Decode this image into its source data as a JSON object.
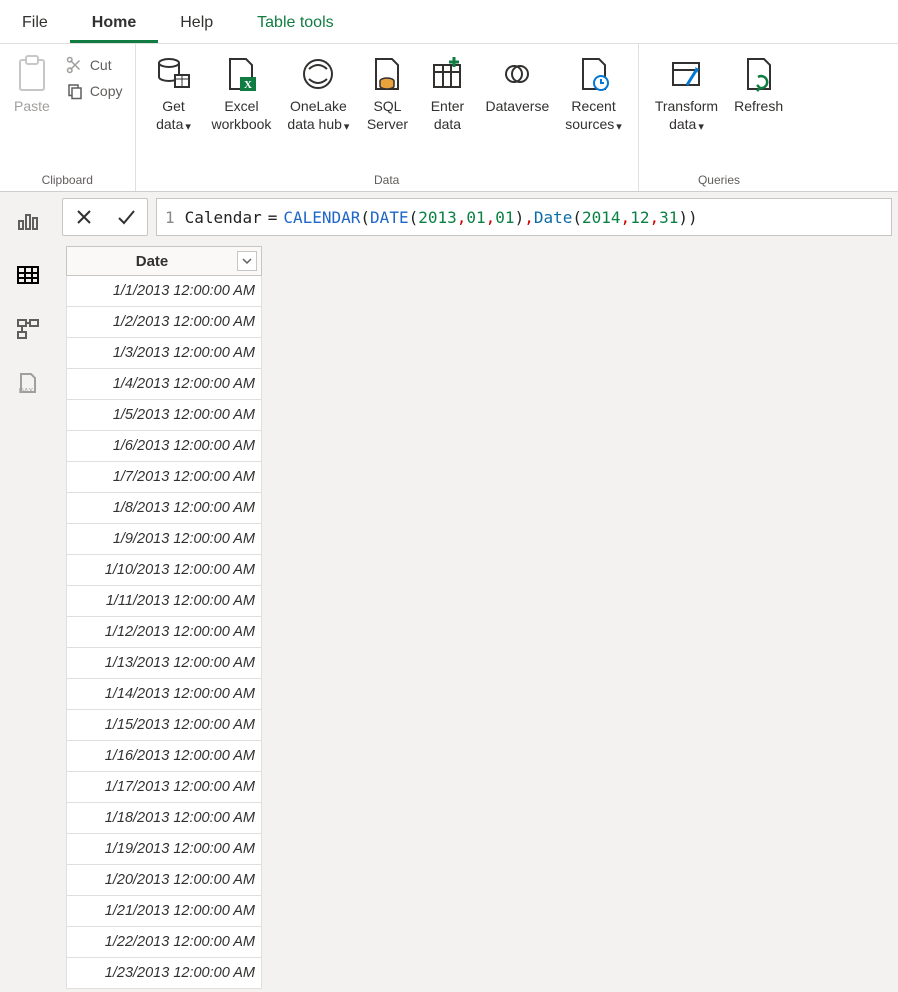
{
  "tabs": {
    "file": "File",
    "home": "Home",
    "help": "Help",
    "table_tools": "Table tools"
  },
  "ribbon": {
    "clipboard": {
      "paste": "Paste",
      "cut": "Cut",
      "copy": "Copy",
      "group_label": "Clipboard"
    },
    "data": {
      "get_data": "Get\ndata",
      "excel_workbook": "Excel\nworkbook",
      "onelake": "OneLake\ndata hub",
      "sql_server": "SQL\nServer",
      "enter_data": "Enter\ndata",
      "dataverse": "Dataverse",
      "recent_sources": "Recent\nsources",
      "group_label": "Data"
    },
    "queries": {
      "transform_data": "Transform\ndata",
      "refresh": "Refresh",
      "group_label": "Queries"
    }
  },
  "formula": {
    "line_number": "1",
    "identifier": "Calendar",
    "equals": "=",
    "fn1": "CALENDAR",
    "open1": "(",
    "fn2a": "DATE",
    "open2a": "(",
    "y1": "2013",
    "m1": "01",
    "d1": "01",
    "close2a": ")",
    "comma_mid": ",",
    "fn2b": "Date",
    "open2b": "(",
    "y2": "2014",
    "m2": "12",
    "d2": "31",
    "close2b": ")",
    "close1": ")",
    "comma": ","
  },
  "table": {
    "column_header": "Date",
    "rows": [
      "1/1/2013 12:00:00 AM",
      "1/2/2013 12:00:00 AM",
      "1/3/2013 12:00:00 AM",
      "1/4/2013 12:00:00 AM",
      "1/5/2013 12:00:00 AM",
      "1/6/2013 12:00:00 AM",
      "1/7/2013 12:00:00 AM",
      "1/8/2013 12:00:00 AM",
      "1/9/2013 12:00:00 AM",
      "1/10/2013 12:00:00 AM",
      "1/11/2013 12:00:00 AM",
      "1/12/2013 12:00:00 AM",
      "1/13/2013 12:00:00 AM",
      "1/14/2013 12:00:00 AM",
      "1/15/2013 12:00:00 AM",
      "1/16/2013 12:00:00 AM",
      "1/17/2013 12:00:00 AM",
      "1/18/2013 12:00:00 AM",
      "1/19/2013 12:00:00 AM",
      "1/20/2013 12:00:00 AM",
      "1/21/2013 12:00:00 AM",
      "1/22/2013 12:00:00 AM",
      "1/23/2013 12:00:00 AM"
    ]
  }
}
